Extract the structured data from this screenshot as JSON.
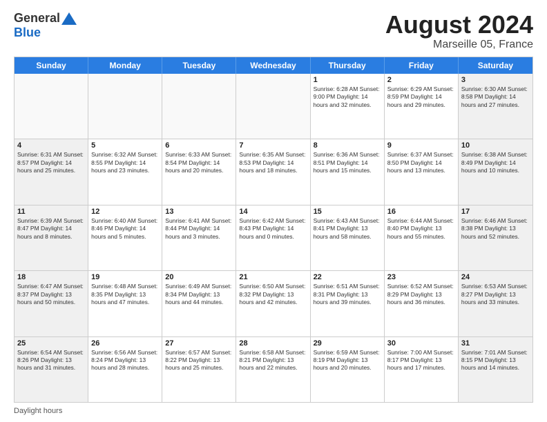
{
  "logo": {
    "general": "General",
    "blue": "Blue"
  },
  "title": "August 2024",
  "location": "Marseille 05, France",
  "footer_label": "Daylight hours",
  "days_of_week": [
    "Sunday",
    "Monday",
    "Tuesday",
    "Wednesday",
    "Thursday",
    "Friday",
    "Saturday"
  ],
  "weeks": [
    [
      {
        "day": "",
        "info": ""
      },
      {
        "day": "",
        "info": ""
      },
      {
        "day": "",
        "info": ""
      },
      {
        "day": "",
        "info": ""
      },
      {
        "day": "1",
        "info": "Sunrise: 6:28 AM\nSunset: 9:00 PM\nDaylight: 14 hours and 32 minutes."
      },
      {
        "day": "2",
        "info": "Sunrise: 6:29 AM\nSunset: 8:59 PM\nDaylight: 14 hours and 29 minutes."
      },
      {
        "day": "3",
        "info": "Sunrise: 6:30 AM\nSunset: 8:58 PM\nDaylight: 14 hours and 27 minutes."
      }
    ],
    [
      {
        "day": "4",
        "info": "Sunrise: 6:31 AM\nSunset: 8:57 PM\nDaylight: 14 hours and 25 minutes."
      },
      {
        "day": "5",
        "info": "Sunrise: 6:32 AM\nSunset: 8:55 PM\nDaylight: 14 hours and 23 minutes."
      },
      {
        "day": "6",
        "info": "Sunrise: 6:33 AM\nSunset: 8:54 PM\nDaylight: 14 hours and 20 minutes."
      },
      {
        "day": "7",
        "info": "Sunrise: 6:35 AM\nSunset: 8:53 PM\nDaylight: 14 hours and 18 minutes."
      },
      {
        "day": "8",
        "info": "Sunrise: 6:36 AM\nSunset: 8:51 PM\nDaylight: 14 hours and 15 minutes."
      },
      {
        "day": "9",
        "info": "Sunrise: 6:37 AM\nSunset: 8:50 PM\nDaylight: 14 hours and 13 minutes."
      },
      {
        "day": "10",
        "info": "Sunrise: 6:38 AM\nSunset: 8:49 PM\nDaylight: 14 hours and 10 minutes."
      }
    ],
    [
      {
        "day": "11",
        "info": "Sunrise: 6:39 AM\nSunset: 8:47 PM\nDaylight: 14 hours and 8 minutes."
      },
      {
        "day": "12",
        "info": "Sunrise: 6:40 AM\nSunset: 8:46 PM\nDaylight: 14 hours and 5 minutes."
      },
      {
        "day": "13",
        "info": "Sunrise: 6:41 AM\nSunset: 8:44 PM\nDaylight: 14 hours and 3 minutes."
      },
      {
        "day": "14",
        "info": "Sunrise: 6:42 AM\nSunset: 8:43 PM\nDaylight: 14 hours and 0 minutes."
      },
      {
        "day": "15",
        "info": "Sunrise: 6:43 AM\nSunset: 8:41 PM\nDaylight: 13 hours and 58 minutes."
      },
      {
        "day": "16",
        "info": "Sunrise: 6:44 AM\nSunset: 8:40 PM\nDaylight: 13 hours and 55 minutes."
      },
      {
        "day": "17",
        "info": "Sunrise: 6:46 AM\nSunset: 8:38 PM\nDaylight: 13 hours and 52 minutes."
      }
    ],
    [
      {
        "day": "18",
        "info": "Sunrise: 6:47 AM\nSunset: 8:37 PM\nDaylight: 13 hours and 50 minutes."
      },
      {
        "day": "19",
        "info": "Sunrise: 6:48 AM\nSunset: 8:35 PM\nDaylight: 13 hours and 47 minutes."
      },
      {
        "day": "20",
        "info": "Sunrise: 6:49 AM\nSunset: 8:34 PM\nDaylight: 13 hours and 44 minutes."
      },
      {
        "day": "21",
        "info": "Sunrise: 6:50 AM\nSunset: 8:32 PM\nDaylight: 13 hours and 42 minutes."
      },
      {
        "day": "22",
        "info": "Sunrise: 6:51 AM\nSunset: 8:31 PM\nDaylight: 13 hours and 39 minutes."
      },
      {
        "day": "23",
        "info": "Sunrise: 6:52 AM\nSunset: 8:29 PM\nDaylight: 13 hours and 36 minutes."
      },
      {
        "day": "24",
        "info": "Sunrise: 6:53 AM\nSunset: 8:27 PM\nDaylight: 13 hours and 33 minutes."
      }
    ],
    [
      {
        "day": "25",
        "info": "Sunrise: 6:54 AM\nSunset: 8:26 PM\nDaylight: 13 hours and 31 minutes."
      },
      {
        "day": "26",
        "info": "Sunrise: 6:56 AM\nSunset: 8:24 PM\nDaylight: 13 hours and 28 minutes."
      },
      {
        "day": "27",
        "info": "Sunrise: 6:57 AM\nSunset: 8:22 PM\nDaylight: 13 hours and 25 minutes."
      },
      {
        "day": "28",
        "info": "Sunrise: 6:58 AM\nSunset: 8:21 PM\nDaylight: 13 hours and 22 minutes."
      },
      {
        "day": "29",
        "info": "Sunrise: 6:59 AM\nSunset: 8:19 PM\nDaylight: 13 hours and 20 minutes."
      },
      {
        "day": "30",
        "info": "Sunrise: 7:00 AM\nSunset: 8:17 PM\nDaylight: 13 hours and 17 minutes."
      },
      {
        "day": "31",
        "info": "Sunrise: 7:01 AM\nSunset: 8:15 PM\nDaylight: 13 hours and 14 minutes."
      }
    ]
  ]
}
